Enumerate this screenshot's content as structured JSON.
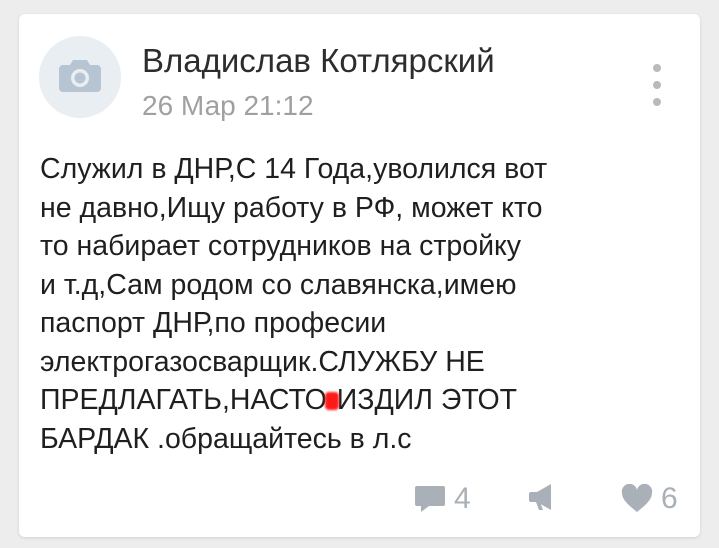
{
  "post": {
    "author": "Владислав Котлярский",
    "date": "26 Мар 21:12",
    "lines": [
      "Служил в ДНР,С 14 Года,уволился вот",
      "не давно,Ищу работу в РФ, может кто",
      "то набирает сотрудников на стройку",
      "и т.д,Сам родом со славянска,имею",
      "паспорт ДНР,по професии",
      "электрогазосварщик.СЛУЖБУ НЕ",
      "ИЗДИЛ ЭТОТ",
      "БАРДАК .обращайтесь в л.с"
    ],
    "line7_prefix": "ПРЕДЛАГАТЬ,НАСТО",
    "line7_suffix": "ИЗДИЛ ЭТОТ"
  },
  "actions": {
    "comments_count": "4",
    "likes_count": "6"
  },
  "icons": {
    "avatar": "camera-icon",
    "menu": "more-vertical-icon",
    "comment": "comment-icon",
    "share": "megaphone-icon",
    "like": "heart-icon"
  },
  "colors": {
    "card_bg": "#ffffff",
    "page_bg": "#ededed",
    "icon_gray": "#aab0b7",
    "date_gray": "#a0a0a0",
    "redaction_red": "#ff1a1a"
  }
}
